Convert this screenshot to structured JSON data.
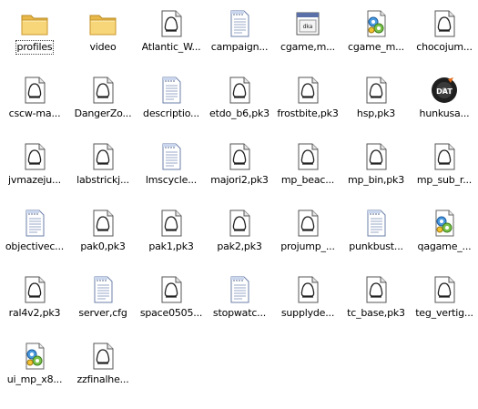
{
  "items": [
    {
      "label": "profiles",
      "icon": "folder-icon",
      "selected": true
    },
    {
      "label": "video",
      "icon": "folder-icon"
    },
    {
      "label": "Atlantic_W...",
      "icon": "pk3-file-icon"
    },
    {
      "label": "campaign...",
      "icon": "text-file-icon"
    },
    {
      "label": "cgame,m...",
      "icon": "dat-window-icon"
    },
    {
      "label": "cgame_m...",
      "icon": "dll-file-icon"
    },
    {
      "label": "chocojum...",
      "icon": "pk3-file-icon"
    },
    {
      "label": "cscw-ma...",
      "icon": "pk3-file-icon"
    },
    {
      "label": "DangerZo...",
      "icon": "pk3-file-icon"
    },
    {
      "label": "descriptio...",
      "icon": "text-file-icon"
    },
    {
      "label": "etdo_b6,pk3",
      "icon": "pk3-file-icon"
    },
    {
      "label": "frostbite,pk3",
      "icon": "pk3-file-icon"
    },
    {
      "label": "hsp,pk3",
      "icon": "pk3-file-icon"
    },
    {
      "label": "hunkusa...",
      "icon": "dat-disc-icon"
    },
    {
      "label": "jvmazeju...",
      "icon": "pk3-file-icon"
    },
    {
      "label": "labstrickj...",
      "icon": "pk3-file-icon"
    },
    {
      "label": "lmscycle...",
      "icon": "text-file-icon"
    },
    {
      "label": "majori2,pk3",
      "icon": "pk3-file-icon"
    },
    {
      "label": "mp_beac...",
      "icon": "pk3-file-icon"
    },
    {
      "label": "mp_bin,pk3",
      "icon": "pk3-file-icon"
    },
    {
      "label": "mp_sub_r...",
      "icon": "pk3-file-icon"
    },
    {
      "label": "objectivec...",
      "icon": "text-file-icon"
    },
    {
      "label": "pak0,pk3",
      "icon": "pk3-file-icon"
    },
    {
      "label": "pak1,pk3",
      "icon": "pk3-file-icon"
    },
    {
      "label": "pak2,pk3",
      "icon": "pk3-file-icon"
    },
    {
      "label": "projump_...",
      "icon": "pk3-file-icon"
    },
    {
      "label": "punkbust...",
      "icon": "text-file-icon"
    },
    {
      "label": "qagame_...",
      "icon": "dll-file-icon"
    },
    {
      "label": "ral4v2,pk3",
      "icon": "pk3-file-icon"
    },
    {
      "label": "server,cfg",
      "icon": "text-file-icon"
    },
    {
      "label": "space0505...",
      "icon": "pk3-file-icon"
    },
    {
      "label": "stopwatc...",
      "icon": "text-file-icon"
    },
    {
      "label": "supplyde...",
      "icon": "pk3-file-icon"
    },
    {
      "label": "tc_base,pk3",
      "icon": "pk3-file-icon"
    },
    {
      "label": "teg_vertig...",
      "icon": "pk3-file-icon"
    },
    {
      "label": "ui_mp_x8...",
      "icon": "dll-file-icon"
    },
    {
      "label": "zzfinalhe...",
      "icon": "pk3-file-icon"
    }
  ],
  "dat_badge_text": "DAT"
}
